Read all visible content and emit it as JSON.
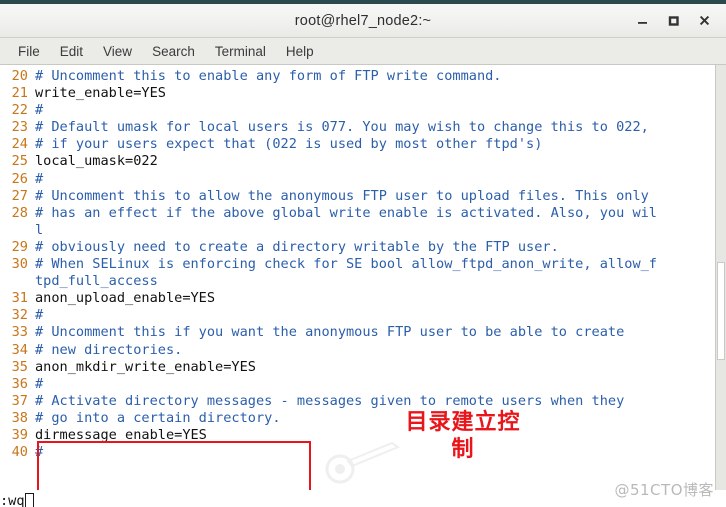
{
  "window": {
    "title": "root@rhel7_node2:~",
    "controls": [
      {
        "name": "minimize",
        "glyph": "–"
      },
      {
        "name": "maximize",
        "glyph": "□"
      },
      {
        "name": "close",
        "glyph": "✕"
      }
    ]
  },
  "menubar": {
    "items": [
      "File",
      "Edit",
      "View",
      "Search",
      "Terminal",
      "Help"
    ]
  },
  "editor": {
    "lines": [
      {
        "num": "20",
        "text": "# Uncomment this to enable any form of FTP write command.",
        "comment": true
      },
      {
        "num": "21",
        "text": "write_enable=YES",
        "comment": false
      },
      {
        "num": "22",
        "text": "#",
        "comment": true
      },
      {
        "num": "23",
        "text": "# Default umask for local users is 077. You may wish to change this to 022,",
        "comment": true
      },
      {
        "num": "24",
        "text": "# if your users expect that (022 is used by most other ftpd's)",
        "comment": true
      },
      {
        "num": "25",
        "text": "local_umask=022",
        "comment": false
      },
      {
        "num": "26",
        "text": "#",
        "comment": true
      },
      {
        "num": "27",
        "text": "# Uncomment this to allow the anonymous FTP user to upload files. This only",
        "comment": true
      },
      {
        "num": "28",
        "text": "# has an effect if the above global write enable is activated. Also, you wil",
        "comment": true
      },
      {
        "num": "",
        "text": "l",
        "comment": true
      },
      {
        "num": "29",
        "text": "# obviously need to create a directory writable by the FTP user.",
        "comment": true
      },
      {
        "num": "30",
        "text": "# When SELinux is enforcing check for SE bool allow_ftpd_anon_write, allow_f",
        "comment": true
      },
      {
        "num": "",
        "text": "tpd_full_access",
        "comment": true
      },
      {
        "num": "31",
        "text": "anon_upload_enable=YES",
        "comment": false
      },
      {
        "num": "32",
        "text": "#",
        "comment": true
      },
      {
        "num": "33",
        "text": "# Uncomment this if you want the anonymous FTP user to be able to create",
        "comment": true
      },
      {
        "num": "34",
        "text": "# new directories.",
        "comment": true
      },
      {
        "num": "35",
        "text": "anon_mkdir_write_enable=YES",
        "comment": false
      },
      {
        "num": "36",
        "text": "#",
        "comment": true
      },
      {
        "num": "37",
        "text": "# Activate directory messages - messages given to remote users when they",
        "comment": true
      },
      {
        "num": "38",
        "text": "# go into a certain directory.",
        "comment": true
      },
      {
        "num": "39",
        "text": "dirmessage_enable=YES",
        "comment": false
      },
      {
        "num": "40",
        "text": "#",
        "comment": true
      }
    ]
  },
  "statusline": {
    "command": ":wq"
  },
  "annotations": {
    "chinese_note_line1": "目录建立控",
    "chinese_note_line2": "制",
    "watermark": "@51CTO博客"
  },
  "colors": {
    "line_number": "#c8761a",
    "comment": "#2b5eab",
    "code": "#111111",
    "annotation_red": "#e8151b",
    "titlebar_border": "#2b4a4e",
    "background": "#ffffff"
  }
}
